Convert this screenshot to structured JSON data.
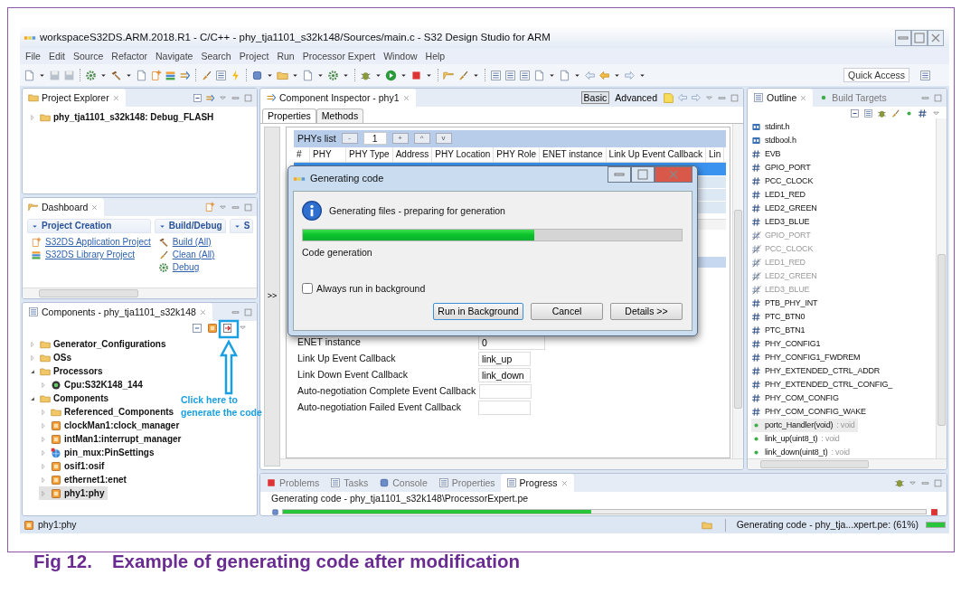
{
  "window": {
    "title": "workspaceS32DS.ARM.2018.R1 - C/C++ - phy_tja1101_s32k148/Sources/main.c - S32 Design Studio for ARM"
  },
  "menu": [
    "File",
    "Edit",
    "Source",
    "Refactor",
    "Navigate",
    "Search",
    "Project",
    "Run",
    "Processor Expert",
    "Window",
    "Help"
  ],
  "toolbar": {
    "quick_access": "Quick Access"
  },
  "project_explorer": {
    "title": "Project Explorer",
    "items": [
      {
        "label": "phy_tja1101_s32k148: Debug_FLASH",
        "expanded": false
      }
    ]
  },
  "dashboard": {
    "title": "Dashboard",
    "sections": [
      {
        "title": "Project Creation",
        "items": [
          {
            "label": "S32DS Application Project",
            "kind": "new-project"
          },
          {
            "label": "S32DS Library Project",
            "kind": "library"
          }
        ]
      },
      {
        "title": "Build/Debug",
        "items": [
          {
            "label": "Build  (All)",
            "kind": "build"
          },
          {
            "label": "Clean  (All)",
            "kind": "clean"
          },
          {
            "label": "Debug",
            "kind": "debug"
          }
        ]
      },
      {
        "title": "S"
      }
    ]
  },
  "components": {
    "title": "Components - phy_tja1101_s32k148",
    "tree": [
      {
        "label": "Generator_Configurations",
        "kind": "folder",
        "expanded": false,
        "selected": false
      },
      {
        "label": "OSs",
        "kind": "folder",
        "expanded": false,
        "selected": false
      },
      {
        "label": "Processors",
        "kind": "folder",
        "expanded": true,
        "selected": false,
        "children": [
          {
            "label": "Cpu:S32K148_144",
            "kind": "cpu",
            "expanded": false,
            "selected": false
          }
        ]
      },
      {
        "label": "Components",
        "kind": "folder",
        "expanded": true,
        "selected": false,
        "children": [
          {
            "label": "Referenced_Components",
            "kind": "folder",
            "expanded": false,
            "selected": false
          },
          {
            "label": "clockMan1:clock_manager",
            "kind": "component",
            "expanded": false,
            "selected": false
          },
          {
            "label": "intMan1:interrupt_manager",
            "kind": "component",
            "expanded": false,
            "selected": false
          },
          {
            "label": "pin_mux:PinSettings",
            "kind": "pins",
            "expanded": false,
            "selected": false
          },
          {
            "label": "osif1:osif",
            "kind": "component",
            "expanded": false,
            "selected": false
          },
          {
            "label": "ethernet1:enet",
            "kind": "component",
            "expanded": false,
            "selected": false
          },
          {
            "label": "phy1:phy",
            "kind": "component",
            "expanded": false,
            "selected": true
          }
        ]
      }
    ]
  },
  "callout": {
    "text": "Click here to generate the code"
  },
  "inspector": {
    "title": "Component Inspector - phy1",
    "modes": [
      {
        "label": "Basic",
        "selected": true
      },
      {
        "label": "Advanced",
        "selected": false
      }
    ],
    "tabs": [
      {
        "label": "Properties",
        "selected": true
      },
      {
        "label": "Methods",
        "selected": false
      }
    ],
    "sidebar_toggle": ">>",
    "phys_list": {
      "label": "PHYs list",
      "buttons": [
        "-",
        "+",
        "^",
        "v"
      ],
      "count": "1",
      "columns": [
        "#",
        "PHY",
        "PHY Type",
        "Address",
        "PHY Location",
        "PHY Role",
        "ENET instance",
        "Link Up Event Callback",
        "Lin"
      ]
    },
    "properties": [
      {
        "label": "ENET instance",
        "value": "0"
      },
      {
        "label": "Link Up Event Callback",
        "value": "link_up"
      },
      {
        "label": "Link Down Event Callback",
        "value": "link_down"
      },
      {
        "label": "Auto-negotiation Complete Event Callback"
      },
      {
        "label": "Auto-negotiation Failed Event Callback"
      }
    ]
  },
  "dialog": {
    "title": "Generating code",
    "message": "Generating files - preparing for generation",
    "level": 0.61,
    "task": "Code generation",
    "checkbox": {
      "label": "Always run in background",
      "checked": false
    },
    "buttons": [
      {
        "label": "Run in Background",
        "default": true
      },
      {
        "label": "Cancel",
        "default": false
      },
      {
        "label": "Details >>",
        "default": false
      }
    ]
  },
  "outline": {
    "tabs": [
      {
        "label": "Outline",
        "selected": true
      },
      {
        "label": "Build Targets",
        "selected": false
      }
    ],
    "items": [
      {
        "kind": "include",
        "label": "stdint.h",
        "selected": false
      },
      {
        "kind": "include",
        "label": "stdbool.h",
        "selected": false
      },
      {
        "kind": "define",
        "label": "EVB",
        "selected": false
      },
      {
        "kind": "define",
        "label": "GPIO_PORT",
        "selected": false
      },
      {
        "kind": "define",
        "label": "PCC_CLOCK",
        "selected": false
      },
      {
        "kind": "define",
        "label": "LED1_RED",
        "selected": false
      },
      {
        "kind": "define",
        "label": "LED2_GREEN",
        "selected": false
      },
      {
        "kind": "define",
        "label": "LED3_BLUE",
        "selected": false
      },
      {
        "kind": "undef",
        "label": "GPIO_PORT",
        "selected": false
      },
      {
        "kind": "undef",
        "label": "PCC_CLOCK",
        "selected": false
      },
      {
        "kind": "undef",
        "label": "LED1_RED",
        "selected": false
      },
      {
        "kind": "undef",
        "label": "LED2_GREEN",
        "selected": false
      },
      {
        "kind": "undef",
        "label": "LED3_BLUE",
        "selected": false
      },
      {
        "kind": "define",
        "label": "PTB_PHY_INT",
        "selected": false
      },
      {
        "kind": "define",
        "label": "PTC_BTN0",
        "selected": false
      },
      {
        "kind": "define",
        "label": "PTC_BTN1",
        "selected": false
      },
      {
        "kind": "define",
        "label": "PHY_CONFIG1",
        "selected": false
      },
      {
        "kind": "define",
        "label": "PHY_CONFIG1_FWDREM",
        "selected": false
      },
      {
        "kind": "define",
        "label": "PHY_EXTENDED_CTRL_ADDR",
        "selected": false
      },
      {
        "kind": "define",
        "label": "PHY_EXTENDED_CTRL_CONFIG_",
        "selected": false
      },
      {
        "kind": "define",
        "label": "PHY_COM_CONFIG",
        "selected": false
      },
      {
        "kind": "define",
        "label": "PHY_COM_CONFIG_WAKE",
        "selected": false
      },
      {
        "kind": "function",
        "label": "portc_Handler(void)",
        "type": " : void",
        "selected": true
      },
      {
        "kind": "function",
        "label": "link_up(uint8_t)",
        "type": " : void",
        "selected": false
      },
      {
        "kind": "function",
        "label": "link_down(uint8_t)",
        "type": " : void",
        "selected": false
      }
    ]
  },
  "bottom_panel": {
    "tabs": [
      {
        "label": "Problems",
        "selected": false
      },
      {
        "label": "Tasks",
        "selected": false
      },
      {
        "label": "Console",
        "selected": false
      },
      {
        "label": "Properties",
        "selected": false
      },
      {
        "label": "Progress",
        "selected": true
      }
    ],
    "task": "Generating code - phy_tja1101_s32k148\\ProcessorExpert.pe",
    "level": 0.48
  },
  "status_bar": {
    "selection": "phy1:phy",
    "progress": "Generating code - phy_tja...xpert.pe: (61%)",
    "level": 1
  },
  "caption": {
    "label": "Fig 12.",
    "text": "Example of generating code after modification"
  }
}
